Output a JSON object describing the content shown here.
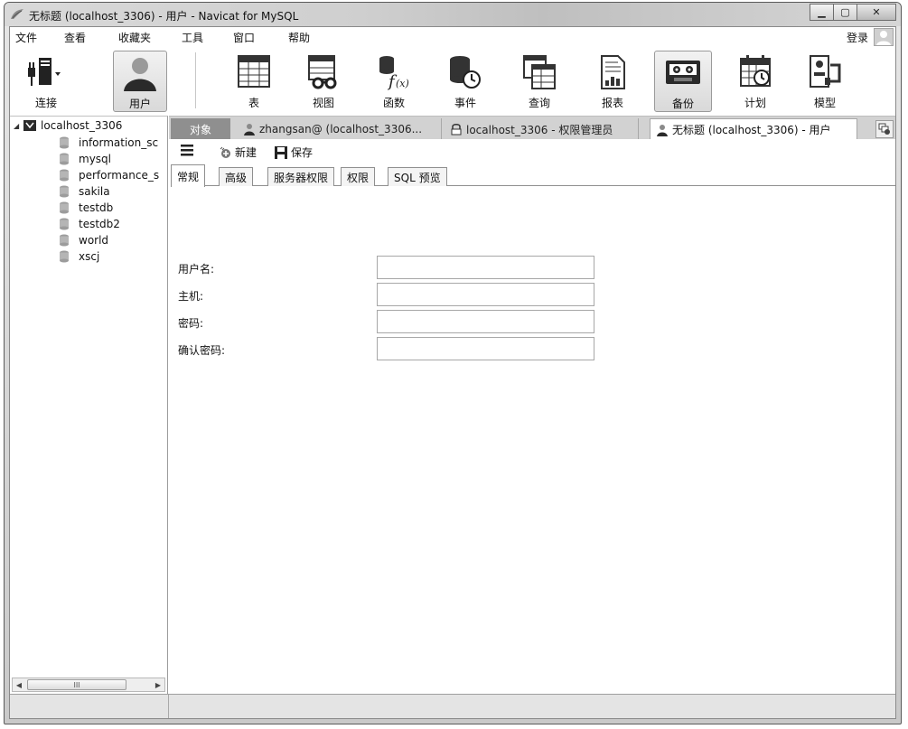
{
  "window": {
    "title": "无标题 (localhost_3306) - 用户 - Navicat for MySQL",
    "controls": {
      "minimize": "▁",
      "maximize": "▢",
      "close": "✕"
    }
  },
  "menu": {
    "items": [
      "文件",
      "查看",
      "收藏夹",
      "工具",
      "窗口",
      "帮助"
    ],
    "login": "登录"
  },
  "toolbar": {
    "items": [
      {
        "label": "连接",
        "icon": "connection-icon"
      },
      {
        "label": "用户",
        "icon": "user-icon",
        "active": true
      },
      {
        "label": "表",
        "icon": "table-icon"
      },
      {
        "label": "视图",
        "icon": "view-icon"
      },
      {
        "label": "函数",
        "icon": "function-icon"
      },
      {
        "label": "事件",
        "icon": "event-icon"
      },
      {
        "label": "查询",
        "icon": "query-icon"
      },
      {
        "label": "报表",
        "icon": "report-icon"
      },
      {
        "label": "备份",
        "icon": "backup-icon"
      },
      {
        "label": "计划",
        "icon": "schedule-icon"
      },
      {
        "label": "模型",
        "icon": "model-icon"
      }
    ]
  },
  "sidebar": {
    "root": "localhost_3306",
    "databases": [
      "information_sc",
      "mysql",
      "performance_s",
      "sakila",
      "testdb",
      "testdb2",
      "world",
      "xscj"
    ],
    "scroll_thumb": "III"
  },
  "tabs": {
    "objects": "对象",
    "items": [
      {
        "label": "zhangsan@ (localhost_3306...",
        "icon": "user-icon"
      },
      {
        "label": "localhost_3306 - 权限管理员",
        "icon": "lock-icon"
      },
      {
        "label": "无标题 (localhost_3306) - 用户",
        "icon": "user-icon",
        "active": true
      }
    ]
  },
  "editor": {
    "new_label": "新建",
    "save_label": "保存",
    "tabs": [
      "常规",
      "高级",
      "服务器权限",
      "权限",
      "SQL 预览"
    ],
    "active_tab": "常规",
    "fields": [
      {
        "label": "用户名:",
        "value": ""
      },
      {
        "label": "主机:",
        "value": ""
      },
      {
        "label": "密码:",
        "value": ""
      },
      {
        "label": "确认密码:",
        "value": ""
      }
    ]
  }
}
